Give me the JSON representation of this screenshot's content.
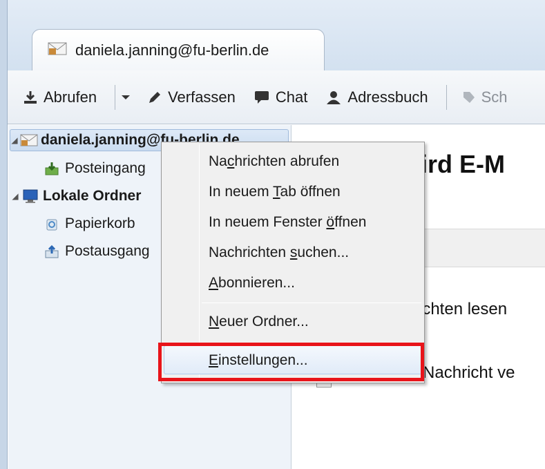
{
  "window": {
    "tab_title": "daniela.janning@fu-berlin.de"
  },
  "toolbar": {
    "get_messages": "Abrufen",
    "compose": "Verfassen",
    "chat": "Chat",
    "address_book": "Adressbuch",
    "tag_partial": "Sch"
  },
  "folders": {
    "account": "daniela.janning@fu-berlin.de",
    "inbox": "Posteingang",
    "local_folders": "Lokale Ordner",
    "trash": "Papierkorb",
    "outbox": "Postausgang"
  },
  "content": {
    "title_partial": "rbird E-M",
    "read_messages_partial": "richten lesen",
    "new_message_partial": "Neue Nachricht ve"
  },
  "context_menu": {
    "items": [
      {
        "before": "Na",
        "accel": "c",
        "after": "hrichten abrufen"
      },
      {
        "before": "In neuem ",
        "accel": "T",
        "after": "ab öffnen"
      },
      {
        "before": "In neuem Fenster ",
        "accel": "ö",
        "after": "ffnen"
      },
      {
        "before": "Nachrichten ",
        "accel": "s",
        "after": "uchen..."
      },
      {
        "before": "",
        "accel": "A",
        "after": "bonnieren..."
      },
      {
        "before": "",
        "accel": "N",
        "after": "euer Ordner..."
      },
      {
        "before": "",
        "accel": "E",
        "after": "instellungen..."
      }
    ]
  },
  "colors": {
    "highlight": "#e8141a",
    "selection": "#cbdcf0"
  }
}
